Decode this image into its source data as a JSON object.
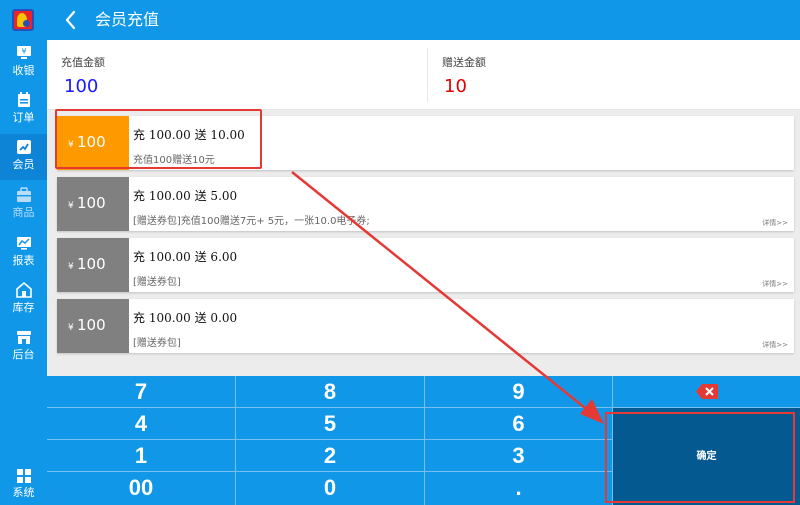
{
  "header": {
    "title": "会员充值"
  },
  "sidebar": {
    "items": [
      {
        "label": "收银",
        "icon": "cashier-icon"
      },
      {
        "label": "订单",
        "icon": "order-icon"
      },
      {
        "label": "会员",
        "icon": "member-icon",
        "active": true
      },
      {
        "label": "商品",
        "icon": "goods-icon"
      },
      {
        "label": "报表",
        "icon": "report-icon"
      },
      {
        "label": "库存",
        "icon": "inventory-icon"
      },
      {
        "label": "后台",
        "icon": "backend-icon"
      }
    ],
    "bottom": {
      "label": "系统",
      "icon": "system-icon"
    }
  },
  "summary": {
    "recharge_label": "充值金额",
    "recharge_value": "100",
    "gift_label": "赠送金额",
    "gift_value": "10"
  },
  "packages": [
    {
      "yen": "¥",
      "amount": "100",
      "title": "充 100.00 送 10.00",
      "desc": "充值100赠送10元",
      "detail": "",
      "selected": true
    },
    {
      "yen": "¥",
      "amount": "100",
      "title": "充 100.00 送 5.00",
      "desc": "[赠送券包]充值100赠送7元+ 5元，一张10.0电子券;",
      "detail": "详情>>"
    },
    {
      "yen": "¥",
      "amount": "100",
      "title": "充 100.00 送 6.00",
      "desc": "[赠送券包]",
      "detail": "详情>>"
    },
    {
      "yen": "¥",
      "amount": "100",
      "title": "充 100.00 送 0.00",
      "desc": "[赠送券包]",
      "detail": "详情>>"
    }
  ],
  "keypad": {
    "keys": [
      "7",
      "8",
      "9",
      "4",
      "5",
      "6",
      "1",
      "2",
      "3",
      "00",
      "0",
      "."
    ],
    "delete_icon": "delete-icon",
    "confirm": "确定"
  },
  "colors": {
    "primary": "#1197e8",
    "selected_price": "#ff9900",
    "unselected_price": "#808080",
    "recharge_value": "#1a1aff",
    "gift_value": "#e60000",
    "confirm_bg": "#045a90",
    "annotation": "#e53935"
  }
}
